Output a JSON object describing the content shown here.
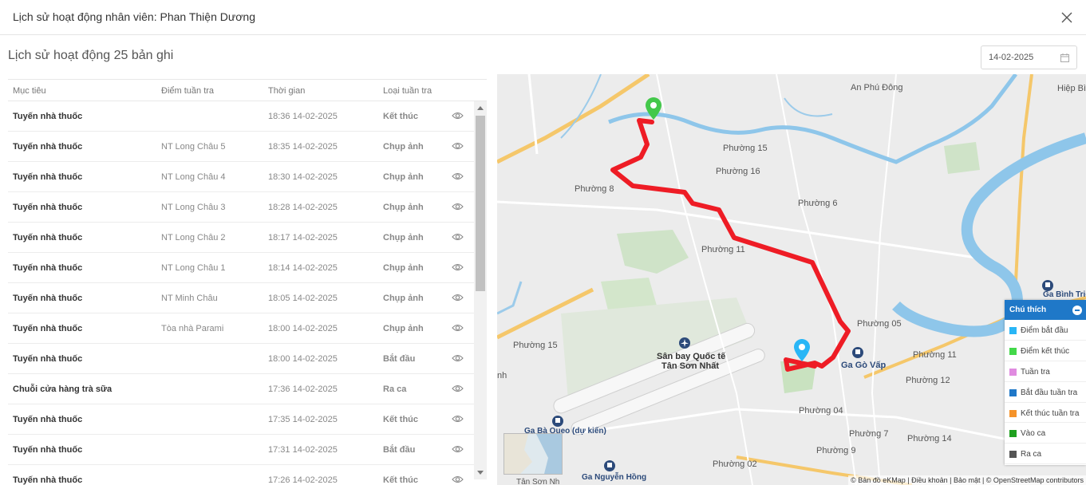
{
  "dialog": {
    "title": "Lịch sử hoạt động nhân viên: Phan Thiện Dương"
  },
  "history": {
    "title": "Lịch sử hoạt động 25 bản ghi"
  },
  "date_filter": {
    "value": "14-02-2025"
  },
  "table": {
    "headers": [
      "Mục tiêu",
      "Điểm tuần tra",
      "Thời gian",
      "Loại tuần tra"
    ],
    "rows": [
      {
        "target": "Tuyến nhà thuốc",
        "point": "",
        "time": "18:36 14-02-2025",
        "type": "Kết thúc"
      },
      {
        "target": "Tuyến nhà thuốc",
        "point": "NT Long Châu 5",
        "time": "18:35 14-02-2025",
        "type": "Chụp ảnh"
      },
      {
        "target": "Tuyến nhà thuốc",
        "point": "NT Long Châu 4",
        "time": "18:30 14-02-2025",
        "type": "Chụp ảnh"
      },
      {
        "target": "Tuyến nhà thuốc",
        "point": "NT Long Châu 3",
        "time": "18:28 14-02-2025",
        "type": "Chụp ảnh"
      },
      {
        "target": "Tuyến nhà thuốc",
        "point": "NT Long Châu 2",
        "time": "18:17 14-02-2025",
        "type": "Chụp ảnh"
      },
      {
        "target": "Tuyến nhà thuốc",
        "point": "NT Long Châu 1",
        "time": "18:14 14-02-2025",
        "type": "Chụp ảnh"
      },
      {
        "target": "Tuyến nhà thuốc",
        "point": "NT Minh Châu",
        "time": "18:05 14-02-2025",
        "type": "Chụp ảnh"
      },
      {
        "target": "Tuyến nhà thuốc",
        "point": "Tòa nhà Parami",
        "time": "18:00 14-02-2025",
        "type": "Chụp ảnh"
      },
      {
        "target": "Tuyến nhà thuốc",
        "point": "",
        "time": "18:00 14-02-2025",
        "type": "Bắt đầu"
      },
      {
        "target": "Chuỗi cửa hàng trà sữa",
        "point": "",
        "time": "17:36 14-02-2025",
        "type": "Ra ca"
      },
      {
        "target": "Tuyến nhà thuốc",
        "point": "",
        "time": "17:35 14-02-2025",
        "type": "Kết thúc"
      },
      {
        "target": "Tuyến nhà thuốc",
        "point": "",
        "time": "17:31 14-02-2025",
        "type": "Bắt đầu"
      },
      {
        "target": "Tuyến nhà thuốc",
        "point": "",
        "time": "17:26 14-02-2025",
        "type": "Kết thúc"
      }
    ]
  },
  "map": {
    "labels": {
      "an_phu_dong": "An Phú Đông",
      "hiep_binh": "Hiệp Bì",
      "phuong15a": "Phường 15",
      "phuong16": "Phường 16",
      "phuong8": "Phường 8",
      "phuong6": "Phường 6",
      "phuong11a": "Phường 11",
      "phuong05": "Phường 05",
      "phuong15b": "Phường 15",
      "san_bay1": "Sân bay Quốc tế",
      "san_bay2": "Tân Sơn Nhất",
      "ga_go_vap": "Ga Gò Vấp",
      "phuong11b": "Phường 11",
      "phuong12": "Phường 12",
      "phuong04": "Phường 04",
      "phuong7": "Phường 7",
      "phuong14": "Phường 14",
      "phuong9": "Phường 9",
      "phuong02": "Phường 02",
      "ga_ba_queo": "Ga Bà Queo (dự kiến)",
      "ga_nguyen_hong": "Ga Nguyễn Hồng",
      "ga_binh_trieu": "Ga Bình Triệu",
      "tan_son_nh": "Tân Sơn Nh",
      "nh": "nh"
    },
    "attribution": "© Bản đồ eKMap | Điều khoản | Bảo mật | © OpenStreetMap contributors"
  },
  "legend": {
    "title": "Chú thích",
    "items": [
      {
        "label": "Điểm bắt đầu",
        "color": "#29b6f6"
      },
      {
        "label": "Điểm kết thúc",
        "color": "#43d84a"
      },
      {
        "label": "Tuần tra",
        "color": "#e08be0"
      },
      {
        "label": "Bắt đầu tuần tra",
        "color": "#1f78c8"
      },
      {
        "label": "Kết thúc tuần tra",
        "color": "#f5932a"
      },
      {
        "label": "Vào ca",
        "color": "#1fa01f"
      },
      {
        "label": "Ra ca",
        "color": "#555555"
      }
    ]
  }
}
